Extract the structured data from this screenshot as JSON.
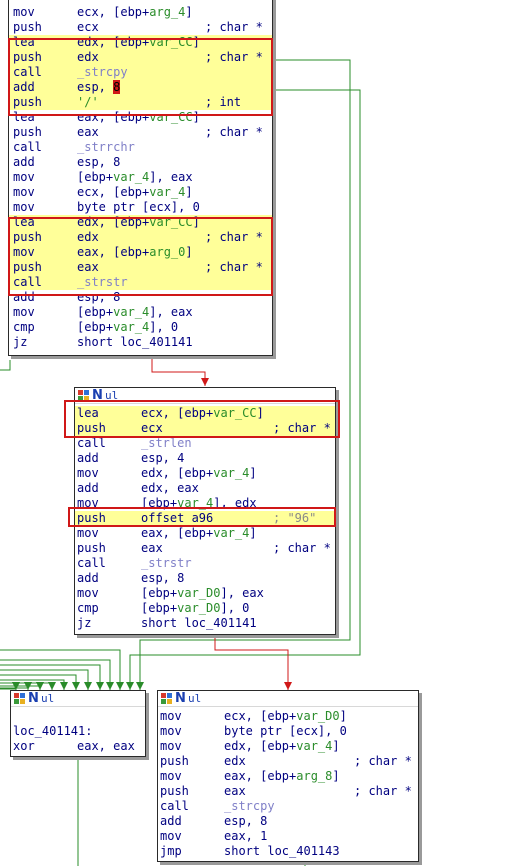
{
  "block_a": {
    "rows": [
      [
        "mov",
        "ecx, [ebp+",
        "arg_4",
        "]",
        ""
      ],
      [
        "push",
        "ecx",
        "",
        "",
        "; char *"
      ],
      [
        "lea",
        "edx, [ebp+",
        "var_CC",
        "]",
        ""
      ],
      [
        "push",
        "edx",
        "",
        "",
        "; char *"
      ],
      [
        "call",
        "",
        "",
        "",
        ""
      ],
      [
        "add",
        "esp, ",
        "",
        "",
        ""
      ],
      [
        "push",
        "'/'",
        "",
        "",
        "; int"
      ],
      [
        "lea",
        "eax, [ebp+",
        "var_CC",
        "]",
        ""
      ],
      [
        "push",
        "eax",
        "",
        "",
        "; char *"
      ],
      [
        "call",
        "",
        "",
        "",
        ""
      ],
      [
        "add",
        "esp, 8",
        "",
        "",
        ""
      ],
      [
        "mov",
        "[ebp+",
        "var_4",
        "], eax",
        ""
      ],
      [
        "mov",
        "ecx, [ebp+",
        "var_4",
        "]",
        ""
      ],
      [
        "mov",
        "byte ptr [ecx], 0",
        "",
        "",
        ""
      ],
      [
        "lea",
        "edx, [ebp+",
        "var_CC",
        "]",
        ""
      ],
      [
        "push",
        "edx",
        "",
        "",
        "; char *"
      ],
      [
        "mov",
        "eax, [ebp+",
        "arg_0",
        "]",
        ""
      ],
      [
        "push",
        "eax",
        "",
        "",
        "; char *"
      ],
      [
        "call",
        "",
        "",
        "",
        ""
      ],
      [
        "add",
        "esp, 8",
        "",
        "",
        ""
      ],
      [
        "mov",
        "[ebp+",
        "var_4",
        "], eax",
        ""
      ],
      [
        "cmp",
        "[ebp+",
        "var_4",
        "], 0",
        ""
      ],
      [
        "jz",
        "short loc_401141",
        "",
        "",
        ""
      ]
    ],
    "calls": {
      "4": "_strcpy",
      "9": "_strrchr",
      "18": "_strstr"
    },
    "add8": "8"
  },
  "block_b": {
    "rows": [
      [
        "lea",
        "ecx, [ebp+",
        "var_CC",
        "]",
        ""
      ],
      [
        "push",
        "ecx",
        "",
        "",
        "; char *"
      ],
      [
        "call",
        "",
        "",
        "",
        ""
      ],
      [
        "add",
        "esp, 4",
        "",
        "",
        ""
      ],
      [
        "mov",
        "edx, [ebp+",
        "var_4",
        "]",
        ""
      ],
      [
        "add",
        "edx, eax",
        "",
        "",
        ""
      ],
      [
        "mov",
        "[ebp+",
        "var_4",
        "], edx",
        ""
      ],
      [
        "push",
        "offset a96",
        "",
        "",
        "; \"96\""
      ],
      [
        "mov",
        "eax, [ebp+",
        "var_4",
        "]",
        ""
      ],
      [
        "push",
        "eax",
        "",
        "",
        "; char *"
      ],
      [
        "call",
        "",
        "",
        "",
        ""
      ],
      [
        "add",
        "esp, 8",
        "",
        "",
        ""
      ],
      [
        "mov",
        "[ebp+",
        "var_D0",
        "], eax",
        ""
      ],
      [
        "cmp",
        "[ebp+",
        "var_D0",
        "], 0",
        ""
      ],
      [
        "jz",
        "short loc_401141",
        "",
        "",
        ""
      ]
    ],
    "calls": {
      "2": "_strlen",
      "10": "_strstr"
    }
  },
  "block_c": {
    "label": "loc_401141:",
    "rows": [
      [
        "xor",
        "eax, eax",
        "",
        "",
        ""
      ]
    ]
  },
  "block_d": {
    "rows": [
      [
        "mov",
        "ecx, [ebp+",
        "var_D0",
        "]",
        ""
      ],
      [
        "mov",
        "byte ptr [ecx], 0",
        "",
        "",
        ""
      ],
      [
        "mov",
        "edx, [ebp+",
        "var_4",
        "]",
        ""
      ],
      [
        "push",
        "edx",
        "",
        "",
        "; char *"
      ],
      [
        "mov",
        "eax, [ebp+",
        "arg_8",
        "]",
        ""
      ],
      [
        "push",
        "eax",
        "",
        "",
        "; char *"
      ],
      [
        "call",
        "",
        "",
        "",
        ""
      ],
      [
        "add",
        "esp, 8",
        "",
        "",
        ""
      ],
      [
        "mov",
        "eax, 1",
        "",
        "",
        ""
      ],
      [
        "jmp",
        "short loc_401143",
        "",
        "",
        ""
      ]
    ],
    "calls": {
      "6": "_strcpy"
    }
  },
  "header": {
    "n": "N",
    "u": "ul"
  },
  "colors": {
    "edge_red": "#d01818",
    "edge_green": "#2a8c2a",
    "highlight": "#ffff99"
  }
}
